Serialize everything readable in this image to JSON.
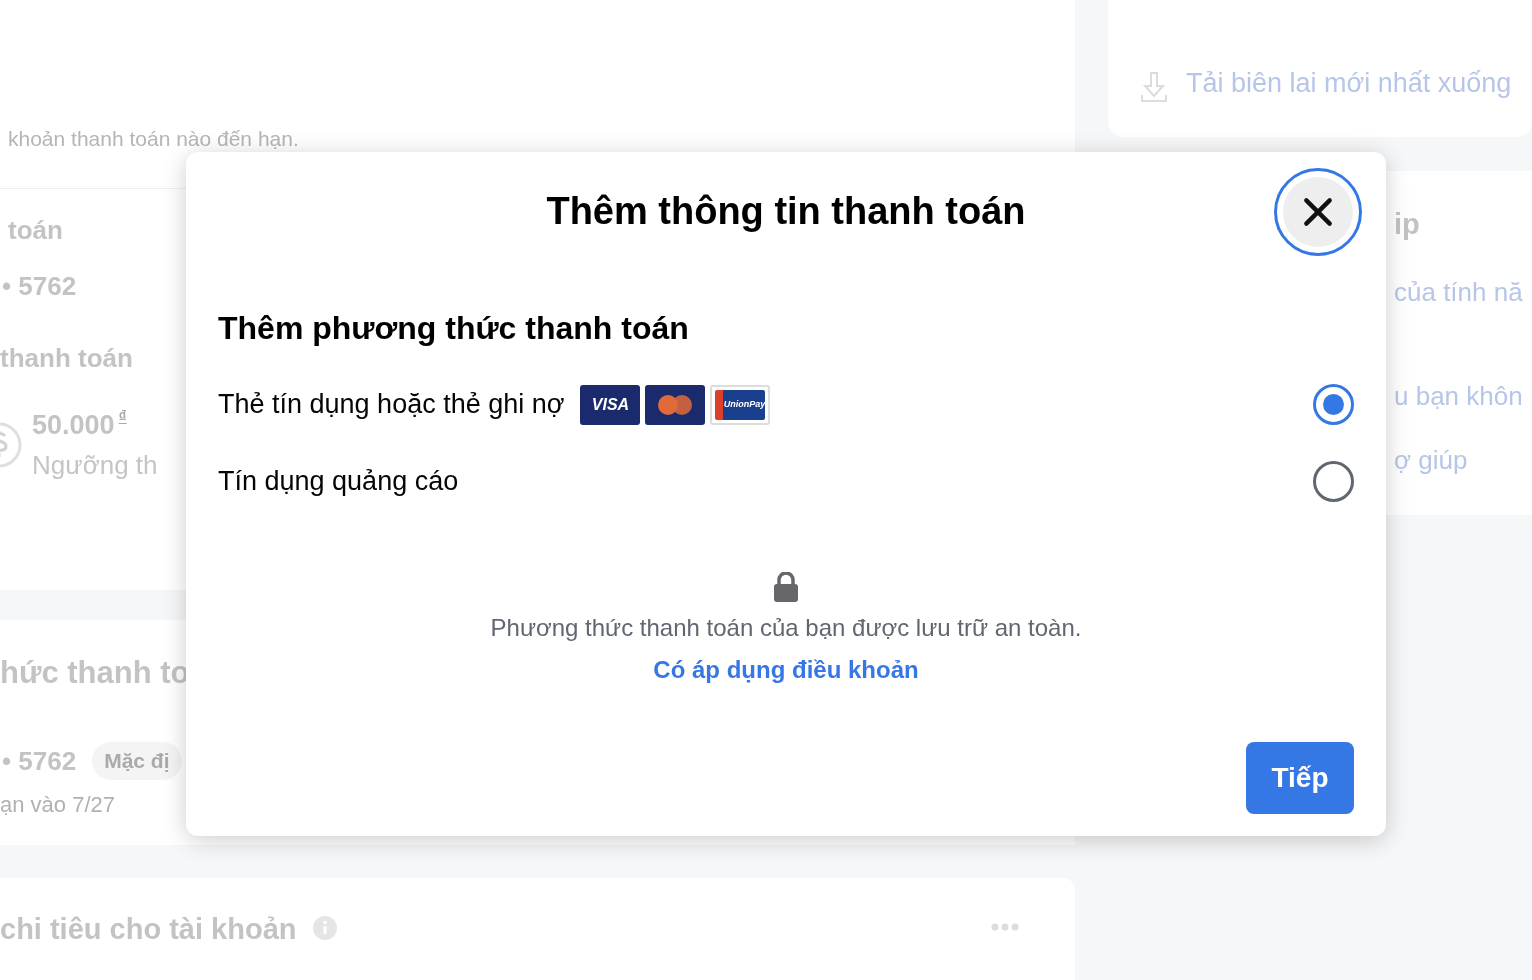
{
  "background": {
    "left": {
      "notice": "khoản thanh toán nào đến hạn.",
      "balance_card": {
        "title": "toán",
        "card_number": "• 5762",
        "section": "thanh toán",
        "amount": "50.000",
        "currency": "₫",
        "threshold": "Ngưỡng th"
      },
      "methods_card": {
        "title": "hức thanh to",
        "card_number": "• 5762",
        "badge": "Mặc đị",
        "due": "ạn vào 7/27"
      },
      "spend_card": {
        "title": "chi tiêu cho tài khoản"
      }
    },
    "right": {
      "receipt_card": {
        "link": "Tải biên lai mới nhất xuống"
      },
      "help_card": {
        "title": "ip",
        "lines": [
          "của tính nă",
          "u bạn khôn",
          "ợ giúp"
        ]
      }
    }
  },
  "modal": {
    "title": "Thêm thông tin thanh toán",
    "heading": "Thêm phương thức thanh toán",
    "options": [
      {
        "label": "Thẻ tín dụng hoặc thẻ ghi nợ",
        "kind": "card",
        "selected": true
      },
      {
        "label": "Tín dụng quảng cáo",
        "kind": "ad_credit",
        "selected": false
      }
    ],
    "card_logos": [
      {
        "kind": "visa",
        "text": "VISA"
      },
      {
        "kind": "mastercard"
      },
      {
        "kind": "unionpay",
        "text": "UnionPay"
      }
    ],
    "secure_note": "Phương thức thanh toán của bạn được lưu trữ an toàn.",
    "terms_link": "Có áp dụng điều khoản",
    "next_button": "Tiếp"
  }
}
